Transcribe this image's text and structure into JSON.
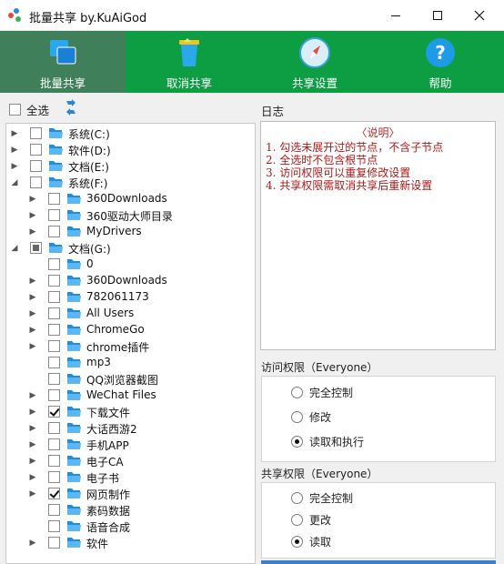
{
  "window": {
    "title": "批量共享 by.KuAiGod"
  },
  "toolbar": {
    "items": [
      {
        "label": "批量共享",
        "icon": "share-windows-icon",
        "active": true
      },
      {
        "label": "取消共享",
        "icon": "trash-icon"
      },
      {
        "label": "共享设置",
        "icon": "compass-icon"
      },
      {
        "label": "帮助",
        "icon": "help-icon"
      }
    ]
  },
  "tree": {
    "select_all_label": "全选",
    "nodes": [
      {
        "label": "系统(C:)",
        "level": 0,
        "expander": "collapsed",
        "state": "unchecked"
      },
      {
        "label": "软件(D:)",
        "level": 0,
        "expander": "collapsed",
        "state": "unchecked"
      },
      {
        "label": "文档(E:)",
        "level": 0,
        "expander": "collapsed",
        "state": "unchecked"
      },
      {
        "label": "系统(F:)",
        "level": 0,
        "expander": "expanded",
        "state": "unchecked"
      },
      {
        "label": "360Downloads",
        "level": 1,
        "expander": "collapsed",
        "state": "unchecked"
      },
      {
        "label": "360驱动大师目录",
        "level": 1,
        "expander": "collapsed",
        "state": "unchecked"
      },
      {
        "label": "MyDrivers",
        "level": 1,
        "expander": "collapsed",
        "state": "unchecked"
      },
      {
        "label": "文档(G:)",
        "level": 0,
        "expander": "expanded",
        "state": "partial"
      },
      {
        "label": "0",
        "level": 1,
        "expander": "none",
        "state": "unchecked"
      },
      {
        "label": "360Downloads",
        "level": 1,
        "expander": "collapsed",
        "state": "unchecked"
      },
      {
        "label": "782061173",
        "level": 1,
        "expander": "collapsed",
        "state": "unchecked"
      },
      {
        "label": "All Users",
        "level": 1,
        "expander": "collapsed",
        "state": "unchecked"
      },
      {
        "label": "ChromeGo",
        "level": 1,
        "expander": "collapsed",
        "state": "unchecked"
      },
      {
        "label": "chrome插件",
        "level": 1,
        "expander": "collapsed",
        "state": "unchecked"
      },
      {
        "label": "mp3",
        "level": 1,
        "expander": "none",
        "state": "unchecked"
      },
      {
        "label": "QQ浏览器截图",
        "level": 1,
        "expander": "none",
        "state": "unchecked"
      },
      {
        "label": "WeChat Files",
        "level": 1,
        "expander": "collapsed",
        "state": "unchecked"
      },
      {
        "label": "下载文件",
        "level": 1,
        "expander": "collapsed",
        "state": "checked"
      },
      {
        "label": "大话西游2",
        "level": 1,
        "expander": "collapsed",
        "state": "unchecked"
      },
      {
        "label": "手机APP",
        "level": 1,
        "expander": "collapsed",
        "state": "unchecked"
      },
      {
        "label": "电子CA",
        "level": 1,
        "expander": "collapsed",
        "state": "unchecked"
      },
      {
        "label": "电子书",
        "level": 1,
        "expander": "collapsed",
        "state": "unchecked"
      },
      {
        "label": "网页制作",
        "level": 1,
        "expander": "collapsed",
        "state": "checked"
      },
      {
        "label": "素码数据",
        "level": 1,
        "expander": "none",
        "state": "unchecked"
      },
      {
        "label": "语音合成",
        "level": 1,
        "expander": "none",
        "state": "unchecked"
      },
      {
        "label": "软件",
        "level": 1,
        "expander": "collapsed",
        "state": "unchecked"
      }
    ]
  },
  "log": {
    "title": "日志",
    "heading": "〈说明〉",
    "lines": [
      "1. 勾选未展开过的节点，不含子节点",
      "2. 全选时不包含根节点",
      "3. 访问权限可以重复修改设置",
      "4. 共享权限需取消共享后重新设置"
    ]
  },
  "access": {
    "title": "访问权限（Everyone）",
    "options": [
      "完全控制",
      "修改",
      "读取和执行"
    ],
    "selected": 2
  },
  "share": {
    "title": "共享权限（Everyone）",
    "options": [
      "完全控制",
      "更改",
      "读取"
    ],
    "selected": 2
  },
  "colors": {
    "toolbar": "#0d9e44",
    "toolbar_active": "#3f7f5a",
    "log_text": "#b01818",
    "folder": "#1f8ee0"
  }
}
